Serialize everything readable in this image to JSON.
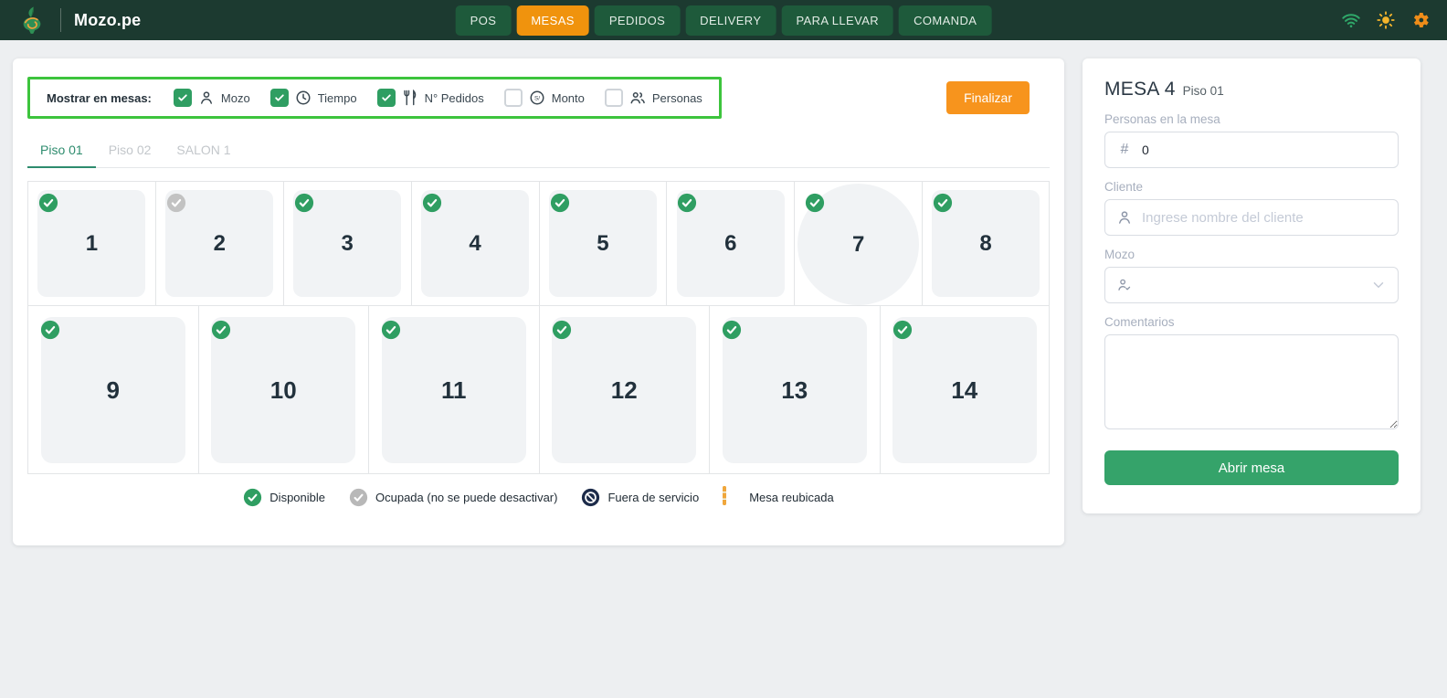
{
  "navbar": {
    "brand": "Mozo.pe",
    "items": [
      {
        "label": "POS",
        "active": false
      },
      {
        "label": "MESAS",
        "active": true
      },
      {
        "label": "PEDIDOS",
        "active": false
      },
      {
        "label": "DELIVERY",
        "active": false
      },
      {
        "label": "PARA LLEVAR",
        "active": false
      },
      {
        "label": "COMANDA",
        "active": false
      }
    ],
    "status_icons": [
      "wifi-icon",
      "brightness-icon",
      "settings-icon"
    ]
  },
  "filters": {
    "label": "Mostrar en mesas:",
    "options": [
      {
        "label": "Mozo",
        "icon": "waiter-icon",
        "checked": true
      },
      {
        "label": "Tiempo",
        "icon": "time-icon",
        "checked": true
      },
      {
        "label": "N° Pedidos",
        "icon": "orders-icon",
        "checked": true
      },
      {
        "label": "Monto",
        "icon": "amount-icon",
        "checked": false
      },
      {
        "label": "Personas",
        "icon": "people-icon",
        "checked": false
      }
    ],
    "finalize_label": "Finalizar"
  },
  "tabs": [
    {
      "label": "Piso 01",
      "active": true
    },
    {
      "label": "Piso 02",
      "active": false
    },
    {
      "label": "SALON 1",
      "active": false
    }
  ],
  "tables": {
    "row1": [
      {
        "number": "1",
        "status": "available",
        "shape": "square"
      },
      {
        "number": "2",
        "status": "occupied",
        "shape": "square"
      },
      {
        "number": "3",
        "status": "available",
        "shape": "square"
      },
      {
        "number": "4",
        "status": "available",
        "shape": "square"
      },
      {
        "number": "5",
        "status": "available",
        "shape": "square"
      },
      {
        "number": "6",
        "status": "available",
        "shape": "square"
      },
      {
        "number": "7",
        "status": "available",
        "shape": "circle"
      },
      {
        "number": "8",
        "status": "available",
        "shape": "square"
      }
    ],
    "row2": [
      {
        "number": "9",
        "status": "available",
        "shape": "square"
      },
      {
        "number": "10",
        "status": "available",
        "shape": "square"
      },
      {
        "number": "11",
        "status": "available",
        "shape": "square"
      },
      {
        "number": "12",
        "status": "available",
        "shape": "square"
      },
      {
        "number": "13",
        "status": "available",
        "shape": "square"
      },
      {
        "number": "14",
        "status": "available",
        "shape": "square"
      }
    ]
  },
  "legend": [
    {
      "label": "Disponible",
      "icon": "check-circle-green"
    },
    {
      "label": "Ocupada (no se puede desactivar)",
      "icon": "check-circle-gray"
    },
    {
      "label": "Fuera de servicio",
      "icon": "out-of-service-icon"
    },
    {
      "label": "Mesa reubicada",
      "icon": "relocated-table-icon"
    }
  ],
  "panel": {
    "title": "MESA 4",
    "subtitle": "Piso 01",
    "persons_label": "Personas en la mesa",
    "persons_value": "0",
    "client_label": "Cliente",
    "client_placeholder": "Ingrese nombre del cliente",
    "waiter_label": "Mozo",
    "comments_label": "Comentarios",
    "open_button_label": "Abrir mesa"
  },
  "colors": {
    "navbar_bg": "#1c3a30",
    "active_nav": "#f0930d",
    "available_green": "#2f9e62",
    "occupied_gray": "#c2c2c2",
    "highlight_border": "#3dc43d",
    "finalize_orange": "#f7941d",
    "open_button_green": "#35a36a"
  }
}
